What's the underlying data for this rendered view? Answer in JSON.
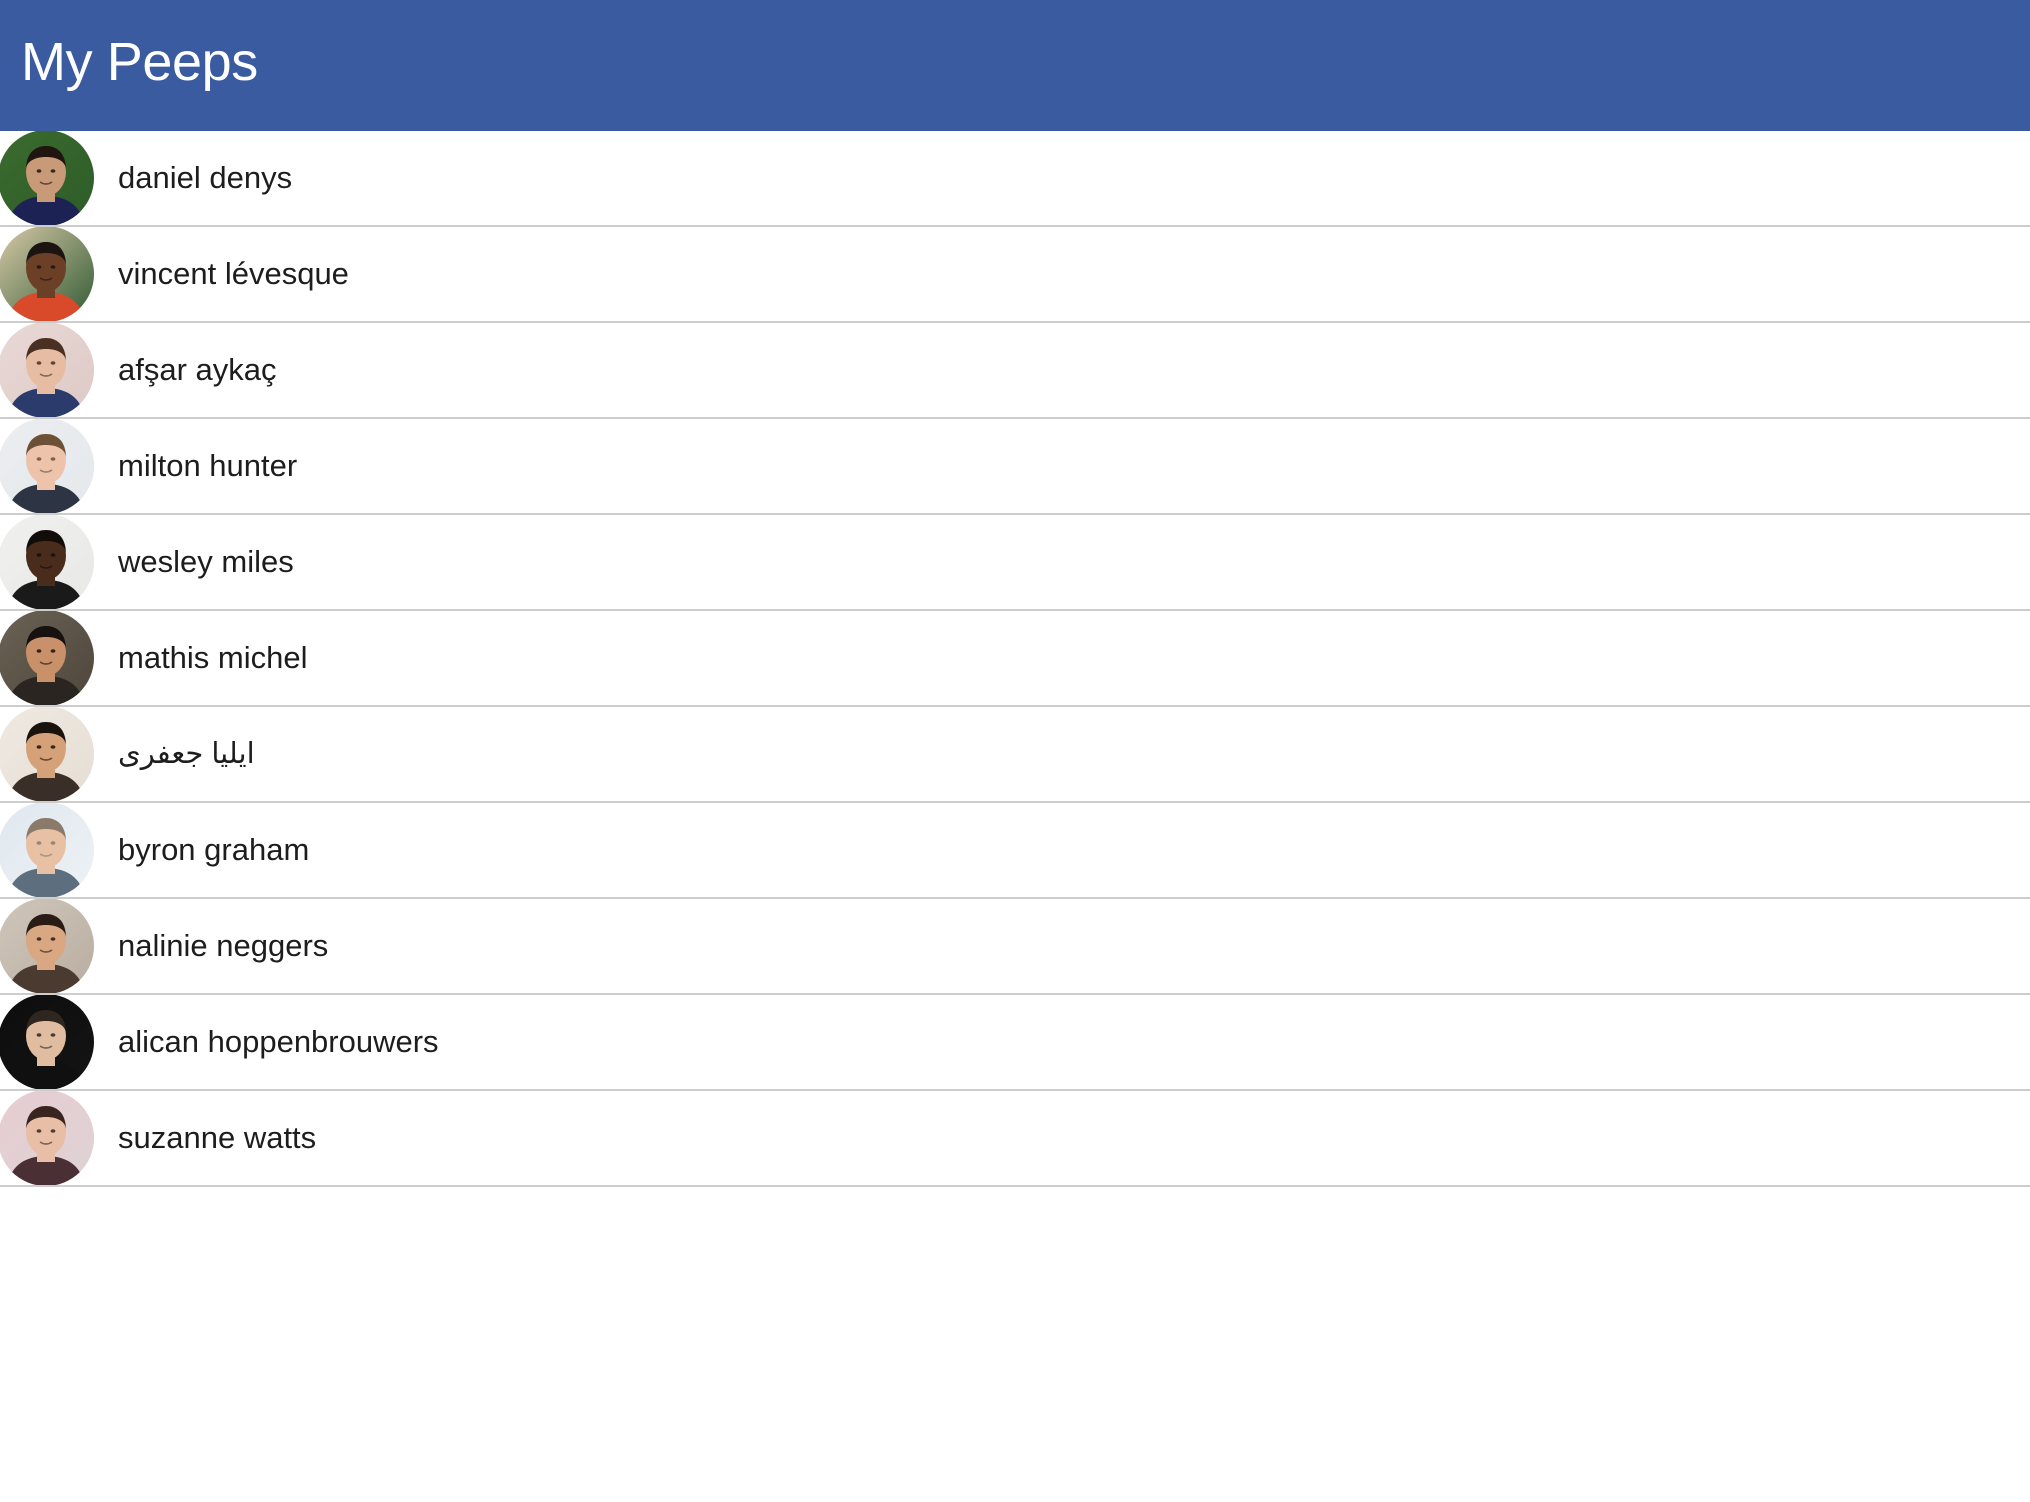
{
  "header": {
    "title": "My Peeps",
    "background_color": "#3a5ba0",
    "text_color": "#ffffff"
  },
  "list": {
    "separator_color": "#cdcdcd",
    "row_count": 11,
    "items": [
      {
        "name": "daniel denys",
        "avatar_name": "avatar-daniel-denys",
        "rtl": false,
        "avatar_colors": {
          "bg_left": "#3b6b2e",
          "bg_right": "#2d5c28",
          "hair": "#20160f",
          "skin": "#c99a78",
          "clothing": "#1d2254"
        }
      },
      {
        "name": "vincent lévesque",
        "avatar_name": "avatar-vincent-levesque",
        "rtl": false,
        "avatar_colors": {
          "bg_left": "#d8c9a8",
          "bg_right": "#2f5a32",
          "hair": "#1b1410",
          "skin": "#6b4027",
          "clothing": "#d94a2b"
        }
      },
      {
        "name": "afşar aykaç",
        "avatar_name": "avatar-afsar-aykac",
        "rtl": false,
        "avatar_colors": {
          "bg_left": "#e9d9d6",
          "bg_right": "#ddc9c6",
          "hair": "#4a2f23",
          "skin": "#e6bda2",
          "clothing": "#2b3b6b"
        }
      },
      {
        "name": "milton hunter",
        "avatar_name": "avatar-milton-hunter",
        "rtl": false,
        "avatar_colors": {
          "bg_left": "#eceef0",
          "bg_right": "#e4e8ec",
          "hair": "#6d5136",
          "skin": "#edc4ab",
          "clothing": "#2d3545"
        }
      },
      {
        "name": "wesley miles",
        "avatar_name": "avatar-wesley-miles",
        "rtl": false,
        "avatar_colors": {
          "bg_left": "#f0f0ee",
          "bg_right": "#e8e8e6",
          "hair": "#130d0a",
          "skin": "#4a2c1c",
          "clothing": "#1a1a1a"
        }
      },
      {
        "name": "mathis michel",
        "avatar_name": "avatar-mathis-michel",
        "rtl": false,
        "avatar_colors": {
          "bg_left": "#6b6255",
          "bg_right": "#4e463b",
          "hair": "#171210",
          "skin": "#c9916a",
          "clothing": "#2a2520"
        }
      },
      {
        "name": "ایلیا جعفری",
        "avatar_name": "avatar-ilya-jafari",
        "rtl": true,
        "avatar_colors": {
          "bg_left": "#efe9e2",
          "bg_right": "#e6ded4",
          "hair": "#1a120d",
          "skin": "#d4a178",
          "clothing": "#3a2f28"
        }
      },
      {
        "name": "byron graham",
        "avatar_name": "avatar-byron-graham",
        "rtl": false,
        "avatar_colors": {
          "bg_left": "#dfe7ef",
          "bg_right": "#eef2f5",
          "hair": "#8a7a6a",
          "skin": "#e8c0a4",
          "clothing": "#5d6f7f"
        }
      },
      {
        "name": "nalinie neggers",
        "avatar_name": "avatar-nalinie-neggers",
        "rtl": false,
        "avatar_colors": {
          "bg_left": "#cfc6bb",
          "bg_right": "#b9ada0",
          "hair": "#2a1c15",
          "skin": "#d9a882",
          "clothing": "#4a3a30"
        }
      },
      {
        "name": "alican hoppenbrouwers",
        "avatar_name": "avatar-alican-hoppenbrouwers",
        "rtl": false,
        "avatar_colors": {
          "bg_left": "#0d0d0d",
          "bg_right": "#141414",
          "hair": "#2f2620",
          "skin": "#e0bda0",
          "clothing": "#101010"
        }
      },
      {
        "name": "suzanne watts",
        "avatar_name": "avatar-suzanne-watts",
        "rtl": false,
        "avatar_colors": {
          "bg_left": "#e7cdd2",
          "bg_right": "#ded2d4",
          "hair": "#3a2420",
          "skin": "#e8bfa6",
          "clothing": "#4a2f35"
        }
      }
    ]
  }
}
